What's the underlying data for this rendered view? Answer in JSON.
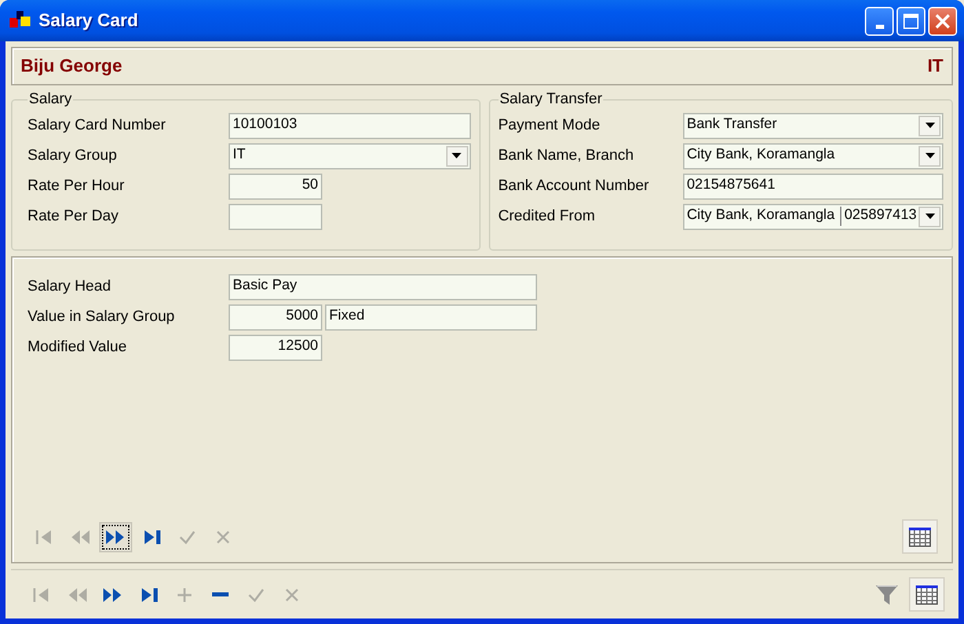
{
  "window": {
    "title": "Salary Card"
  },
  "header": {
    "name": "Biju George",
    "group": "IT"
  },
  "salary": {
    "title": "Salary",
    "fields": [
      {
        "label": "Salary Card Number",
        "kind": "text",
        "values": [
          "10100103"
        ]
      },
      {
        "label": "Salary Group",
        "kind": "combo",
        "values": [
          "IT"
        ]
      },
      {
        "label": "Rate Per Hour",
        "kind": "number",
        "values": [
          "50"
        ]
      },
      {
        "label": "Rate Per Day",
        "kind": "number"
      }
    ]
  },
  "transfer": {
    "title": "Salary Transfer",
    "fields": [
      {
        "label": "Payment Mode",
        "kind": "combo",
        "values": [
          "Bank Transfer"
        ]
      },
      {
        "label": "Bank Name, Branch",
        "kind": "combo",
        "values": [
          "City Bank, Koramangla"
        ]
      },
      {
        "label": "Bank Account Number",
        "kind": "text",
        "values": [
          "02154875641"
        ]
      },
      {
        "label": "Credited From",
        "kind": "combo",
        "values": [
          "City Bank, Koramangla",
          "025897413"
        ]
      }
    ]
  },
  "detail": {
    "fields": [
      {
        "label": "Salary Head",
        "kind": "text",
        "values": [
          "Basic Pay"
        ]
      },
      {
        "label": "Value in Salary Group",
        "kind": "number",
        "values": [
          "5000",
          "Fixed"
        ]
      },
      {
        "label": "Modified Value",
        "kind": "number",
        "values": [
          "12500"
        ]
      }
    ],
    "navigator": [
      {
        "kind": "first",
        "disabled": true,
        "selected": false
      },
      {
        "kind": "prev",
        "disabled": true,
        "selected": false
      },
      {
        "kind": "next",
        "disabled": false,
        "selected": true
      },
      {
        "kind": "last",
        "disabled": false,
        "selected": false
      },
      {
        "kind": "save",
        "disabled": true,
        "selected": false
      },
      {
        "kind": "cancel",
        "disabled": true,
        "selected": false
      }
    ]
  },
  "navigator": [
    {
      "kind": "first",
      "disabled": true,
      "selected": false
    },
    {
      "kind": "prev",
      "disabled": true,
      "selected": false
    },
    {
      "kind": "next",
      "disabled": false,
      "selected": false
    },
    {
      "kind": "last",
      "disabled": false,
      "selected": false
    },
    {
      "kind": "add",
      "disabled": true,
      "selected": false
    },
    {
      "kind": "remove",
      "disabled": false,
      "selected": false
    },
    {
      "kind": "save",
      "disabled": true,
      "selected": false
    },
    {
      "kind": "cancel",
      "disabled": true,
      "selected": false
    }
  ]
}
